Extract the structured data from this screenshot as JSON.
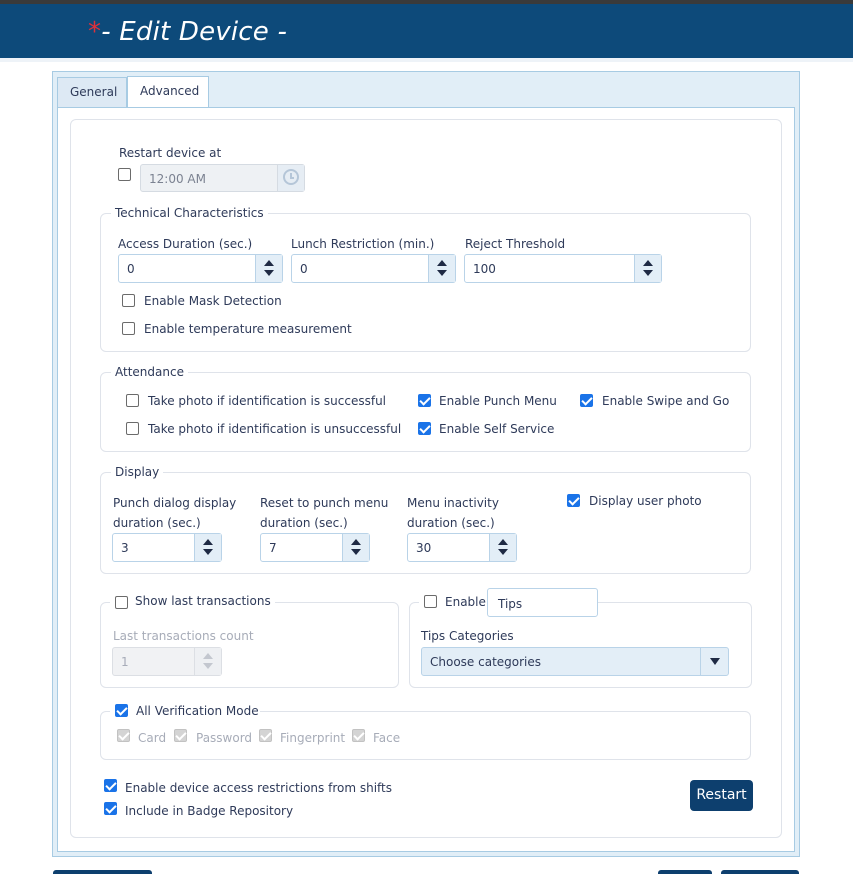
{
  "header": {
    "required_mark": "*",
    "title": "- Edit Device -"
  },
  "tabs": [
    {
      "label": "General",
      "active": false
    },
    {
      "label": "Advanced",
      "active": true
    }
  ],
  "restart_section": {
    "label": "Restart device at",
    "checked": false,
    "time_value": "12:00 AM",
    "icon": "clock-icon"
  },
  "technical": {
    "legend": "Technical Characteristics",
    "access_duration": {
      "label": "Access Duration (sec.)",
      "value": "0"
    },
    "lunch_restriction": {
      "label": "Lunch Restriction (min.)",
      "value": "0"
    },
    "reject_threshold": {
      "label": "Reject Threshold",
      "value": "100"
    },
    "mask_detection": {
      "label": "Enable Mask Detection",
      "checked": false
    },
    "temperature": {
      "label": "Enable temperature measurement",
      "checked": false
    }
  },
  "attendance": {
    "legend": "Attendance",
    "photo_success": {
      "label": "Take photo if identification is successful",
      "checked": false
    },
    "photo_fail": {
      "label": "Take photo if identification is unsuccessful",
      "checked": false
    },
    "punch_menu": {
      "label": "Enable Punch Menu",
      "checked": true
    },
    "self_service": {
      "label": "Enable Self Service",
      "checked": true
    },
    "swipe_go": {
      "label": "Enable Swipe and Go",
      "checked": true
    }
  },
  "display": {
    "legend": "Display",
    "punch_dialog": {
      "label_line1": "Punch dialog display",
      "label_line2": "duration (sec.)",
      "value": "3"
    },
    "reset_punch": {
      "label_line1": "Reset to punch menu",
      "label_line2": "duration (sec.)",
      "value": "7"
    },
    "menu_inactivity": {
      "label_line1": "Menu inactivity",
      "label_line2": "duration (sec.)",
      "value": "30"
    },
    "user_photo": {
      "label": "Display user photo",
      "checked": true
    }
  },
  "last_transactions": {
    "legend": "Show last transactions",
    "checked": false,
    "count_label": "Last transactions count",
    "count_value": "1"
  },
  "tips": {
    "enable_label": "Enable",
    "checked": false,
    "tips_value": "Tips",
    "categories_label": "Tips Categories",
    "categories_value": "Choose categories"
  },
  "verification": {
    "legend": "All Verification Mode",
    "checked": true,
    "modes": [
      "Card",
      "Password",
      "Fingerprint",
      "Face"
    ]
  },
  "footer": {
    "shift_restrictions": {
      "label": "Enable device access restrictions from shifts",
      "checked": true
    },
    "badge_repository": {
      "label": "Include in Badge Repository",
      "checked": true
    },
    "restart_button": "Restart"
  },
  "colors": {
    "header_bg": "#0d4a7a",
    "accent": "#1a73e8",
    "button_bg": "#0d3f6e",
    "required_mark": "#e0303a"
  }
}
